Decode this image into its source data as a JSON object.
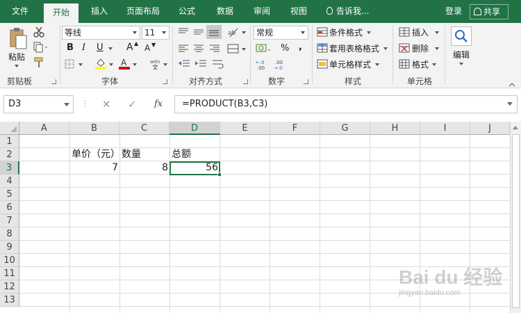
{
  "tabs": {
    "file": "文件",
    "home": "开始",
    "insert": "插入",
    "layout": "页面布局",
    "formulas": "公式",
    "data": "数据",
    "review": "审阅",
    "view": "视图"
  },
  "tell_me": "告诉我...",
  "login": "登录",
  "share": "共享",
  "ribbon": {
    "clipboard": {
      "paste": "粘贴",
      "label": "剪贴板"
    },
    "font": {
      "name": "等线",
      "size": "11",
      "label": "字体",
      "bold": "B",
      "italic": "I",
      "underline": "U",
      "grow": "A",
      "shrink": "A"
    },
    "alignment": {
      "label": "对齐方式"
    },
    "number": {
      "format": "常规",
      "label": "数字",
      "percent": "%",
      "comma": ",",
      "inc_decimal": "+.0\n.00",
      "dec_decimal": ".00\n→.0"
    },
    "styles": {
      "conditional": "条件格式",
      "table": "套用表格格式",
      "cell": "单元格样式",
      "label": "样式"
    },
    "cells": {
      "insert": "插入",
      "delete": "删除",
      "format": "格式",
      "label": "单元格"
    },
    "editing": {
      "label": "编辑"
    }
  },
  "formula_bar": {
    "name_box": "D3",
    "formula": "=PRODUCT(B3,C3)",
    "fx": "fx"
  },
  "grid": {
    "columns": [
      "A",
      "B",
      "C",
      "D",
      "E",
      "F",
      "G",
      "H",
      "I",
      "J"
    ],
    "rows": [
      "1",
      "2",
      "3",
      "4",
      "5",
      "6",
      "7",
      "8",
      "9",
      "10",
      "11",
      "12",
      "13"
    ],
    "cells": {
      "B2": "单价（元）",
      "C2": "数量",
      "D2": "总额",
      "B3": "7",
      "C3": "8",
      "D3": "56"
    },
    "selected": "D3"
  },
  "watermark": {
    "main": "Bai du 经验",
    "sub": "jingyan.baidu.com"
  },
  "colors": {
    "accent": "#217346",
    "ribbon_bg": "#f3f3f3"
  }
}
